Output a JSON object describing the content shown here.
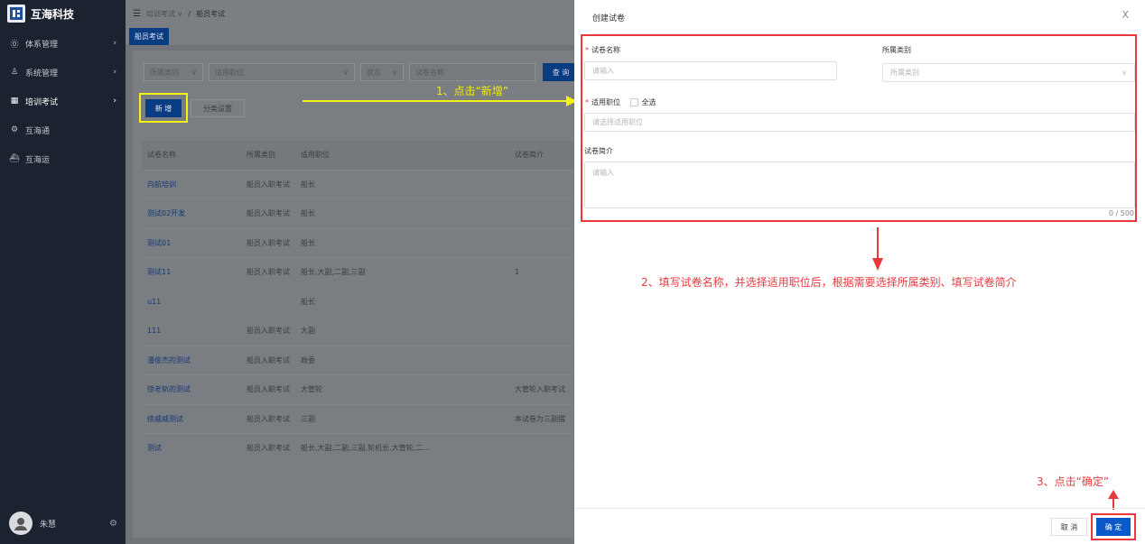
{
  "brand": {
    "name": "互海科技"
  },
  "sidebar": {
    "items": [
      {
        "label": "体系管理",
        "icon": "iso-icon",
        "glyph": "⓪"
      },
      {
        "label": "系统管理",
        "icon": "user-icon",
        "glyph": "♙"
      },
      {
        "label": "培训考试",
        "icon": "grid-icon",
        "glyph": "▦"
      },
      {
        "label": "互海通",
        "icon": "gear-icon",
        "glyph": "⚙"
      },
      {
        "label": "互海运",
        "icon": "ship-icon",
        "glyph": "⛴"
      }
    ],
    "user_name": "朱慧"
  },
  "breadcrumb": {
    "menu_glyph": "☰",
    "parent": "培训考试 ∨",
    "separator": "/",
    "current": "船员考试"
  },
  "tab": {
    "label": "船员考试"
  },
  "filters": {
    "category_placeholder": "所属类别",
    "position_placeholder": "适用职位",
    "status_placeholder": "状态",
    "name_placeholder": "试卷名称",
    "query_label": "查 询"
  },
  "actions": {
    "add_label": "新 增",
    "category_settings_label": "分类设置"
  },
  "table": {
    "headers": [
      "试卷名称",
      "所属类别",
      "适用职位",
      "试卷简介"
    ],
    "rows": [
      [
        "向航培训",
        "船员入职考试",
        "船长",
        ""
      ],
      [
        "测试02开发",
        "船员入职考试",
        "船长",
        ""
      ],
      [
        "测试01",
        "船员入职考试",
        "船长",
        ""
      ],
      [
        "测试11",
        "船员入职考试",
        "船长,大副,二副,三副",
        "1"
      ],
      [
        "u11",
        "",
        "船长",
        ""
      ],
      [
        "111",
        "船员入职考试",
        "大副",
        ""
      ],
      [
        "潘俊杰的测试",
        "船员入职考试",
        "政委",
        ""
      ],
      [
        "徐老轨的测试",
        "船员入职考试",
        "大管轮",
        "大管轮入职考试"
      ],
      [
        "徐威威测试",
        "船员入职考试",
        "三副",
        "本试卷为三副摆"
      ],
      [
        "测试",
        "船员入职考试",
        "船长,大副,二副,三副,轮机长,大管轮,二...",
        ""
      ]
    ]
  },
  "annotations": {
    "step1": "1、点击“新增”",
    "step2": "2、填写试卷名称，并选择适用职位后，根据需要选择所属类别、填写试卷简介",
    "step3": "3、点击“确定”",
    "arrow_color": "#f5f211",
    "highlight_color": "#e8393f"
  },
  "drawer": {
    "title": "创建试卷",
    "close_glyph": "X",
    "name_label": "试卷名称",
    "name_placeholder": "请输入",
    "category_label": "所属类别",
    "category_placeholder": "所属类别",
    "position_label": "适用职位",
    "select_all_label": "全选",
    "position_placeholder": "请选择适用职位",
    "intro_label": "试卷简介",
    "intro_placeholder": "请输入",
    "counter": "0 / 500",
    "cancel_label": "取 消",
    "ok_label": "确 定"
  },
  "colors": {
    "sidebar_bg": "#1b2330",
    "primary": "#0a58c9",
    "required": "#e8393f"
  }
}
